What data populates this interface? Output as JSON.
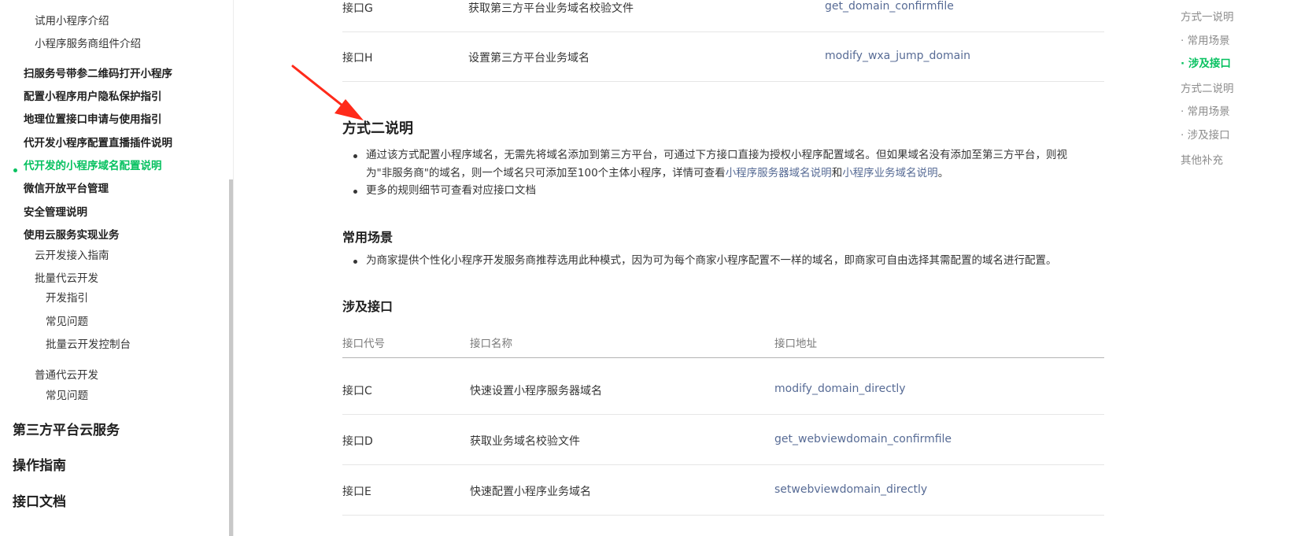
{
  "sidebar": {
    "items_top": [
      {
        "label": "试用小程序介绍",
        "level": 3
      },
      {
        "label": "小程序服务商组件介绍",
        "level": 3
      }
    ],
    "items_main": [
      {
        "label": "扫服务号带参二维码打开小程序"
      },
      {
        "label": "配置小程序用户隐私保护指引"
      },
      {
        "label": "地理位置接口申请与使用指引"
      },
      {
        "label": "代开发小程序配置直播插件说明"
      },
      {
        "label": "代开发的小程序域名配置说明",
        "active": true
      },
      {
        "label": "微信开放平台管理"
      },
      {
        "label": "安全管理说明"
      },
      {
        "label": "使用云服务实现业务"
      }
    ],
    "cloud_items": [
      {
        "label": "云开发接入指南"
      },
      {
        "label": "批量代云开发"
      }
    ],
    "batch_sub": [
      {
        "label": "开发指引"
      },
      {
        "label": "常见问题"
      },
      {
        "label": "批量云开发控制台"
      }
    ],
    "normal_cloud": "普通代云开发",
    "normal_sub": "常见问题",
    "sections": [
      "第三方平台云服务",
      "操作指南",
      "接口文档"
    ]
  },
  "top_table": {
    "rows": [
      {
        "code": "接口G",
        "name": "获取第三方平台业务域名校验文件",
        "api": "get_domain_confirmfile"
      },
      {
        "code": "接口H",
        "name": "设置第三方平台业务域名",
        "api": "modify_wxa_jump_domain"
      }
    ]
  },
  "method2": {
    "title": "方式二说明",
    "bullet1_line1": "通过该方式配置小程序域名，无需先将域名添加到第三方平台，可通过下方接口直接为授权小程序配置域名。但如果域名没有添加至第三方平台，则视",
    "bullet1_line2_pre": "为\"非服务商\"的域名，则一个域名只可添加至100个主体小程序，详情可查看",
    "bullet1_link1": "小程序服务器域名说明",
    "bullet1_and": "和",
    "bullet1_link2": "小程序业务域名说明",
    "bullet1_end": "。",
    "bullet2": "更多的规则细节可查看对应接口文档"
  },
  "scenarios": {
    "title": "常用场景",
    "bullet": "为商家提供个性化小程序开发服务商推荐选用此种模式，因为可为每个商家小程序配置不一样的域名，即商家可自由选择其需配置的域名进行配置。"
  },
  "apis": {
    "title": "涉及接口",
    "headers": {
      "code": "接口代号",
      "name": "接口名称",
      "api": "接口地址"
    },
    "rows": [
      {
        "code": "接口C",
        "name": "快速设置小程序服务器域名",
        "api": "modify_domain_directly"
      },
      {
        "code": "接口D",
        "name": "获取业务域名校验文件",
        "api": "get_webviewdomain_confirmfile"
      },
      {
        "code": "接口E",
        "name": "快速配置小程序业务域名",
        "api": "setwebviewdomain_directly"
      }
    ]
  },
  "toc": {
    "items": [
      {
        "label": "方式一说明"
      },
      {
        "label": "· 常用场景"
      },
      {
        "label": "· 涉及接口",
        "active": true
      },
      {
        "label": "方式二说明"
      },
      {
        "label": "· 常用场景"
      },
      {
        "label": "· 涉及接口"
      },
      {
        "label": "其他补充"
      }
    ]
  },
  "colors": {
    "accent": "#07c160",
    "link": "#576b95",
    "arrow": "#ff2a1a"
  }
}
